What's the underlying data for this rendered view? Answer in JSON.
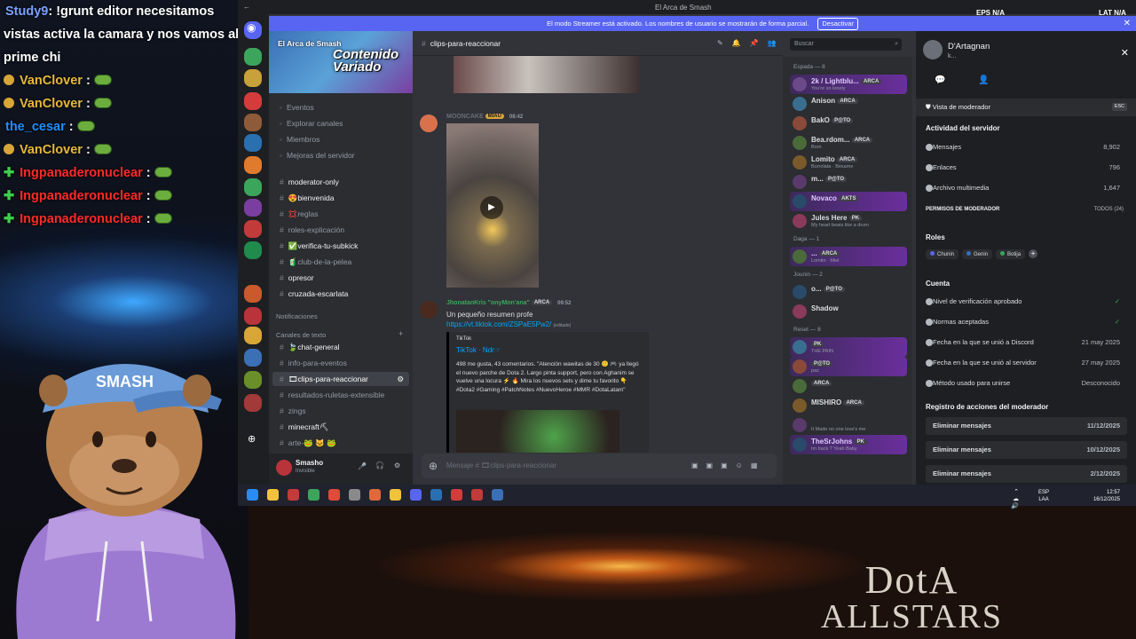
{
  "chat_overlay": [
    {
      "user": "Study9",
      "text": ": !grunt editor necesitamos"
    },
    {
      "user": "",
      "text": "vistas activa la camara y nos vamos al"
    },
    {
      "user": "",
      "text": "prime chi"
    },
    {
      "user": "VanClover",
      "text": " :"
    },
    {
      "user": "VanClover",
      "text": " :"
    },
    {
      "user": "the_cesar",
      "text": " :"
    },
    {
      "user": "VanClover",
      "text": " :"
    },
    {
      "user": "Ingpanaderonuclear",
      "text": " :"
    },
    {
      "user": "Ingpanaderonuclear",
      "text": " :"
    },
    {
      "user": "Ingpanaderonuclear",
      "text": " :"
    }
  ],
  "colors": {
    "vanclover": "#e5b93c",
    "the_cesar": "#1e90ff",
    "ingpanadero": "#ff2a2a",
    "study": "#7aa0ff",
    "blurple": "#5865f2"
  },
  "webcam_overlay": "x317",
  "discord": {
    "window_title": "El Arca de Smash",
    "status_right": "EPS  N/A",
    "status_far": "LAT  N/A",
    "streamer_banner": "El modo Streamer está activado. Los nombres de usuario se mostrarán de forma parcial.",
    "streamer_button": "Desactivar",
    "server_name": "El Arca de Smash",
    "banner_art": "Contenido Variado",
    "nav": [
      "Eventos",
      "Explorar canales",
      "Miembros",
      "Mejoras del servidor"
    ],
    "channels": [
      {
        "name": "moderator-only",
        "strong": true
      },
      {
        "name": "😍bienvenida",
        "strong": true
      },
      {
        "name": "💢reglas",
        "strong": false
      },
      {
        "name": "roles-explicación",
        "strong": false
      },
      {
        "name": "✅verifica-tu-subkick",
        "strong": true
      },
      {
        "name": "🧃club-de-la-pelea",
        "strong": false
      },
      {
        "name": "opresor",
        "strong": true
      },
      {
        "name": "cruzada-escarlata",
        "strong": true
      }
    ],
    "notifications_label": "Notificaciones",
    "text_category": "Canales de texto",
    "text_channels": [
      {
        "name": "🍃chat-general",
        "strong": true,
        "active": false
      },
      {
        "name": "info-para-eventos",
        "strong": false,
        "active": false
      },
      {
        "name": "🎞clips-para-reaccionar",
        "strong": true,
        "active": true
      },
      {
        "name": "resultados-ruletas-extensible",
        "strong": false,
        "active": false
      },
      {
        "name": "zings",
        "strong": false,
        "active": false
      },
      {
        "name": "minecraft⛏",
        "strong": true,
        "active": false
      },
      {
        "name": "arte-🐸 🐱 🐸",
        "strong": false,
        "active": false
      }
    ],
    "user_panel": {
      "name": "Smasho",
      "status": "Invisible"
    },
    "channel_header": "clips-para-reaccionar",
    "search_placeholder": "Buscar",
    "messages": [
      {
        "author": "MOONCAKE",
        "tag": "MIAU",
        "time": "08:42"
      },
      {
        "author": "JhonatanKris \"onyMon'ana\"",
        "tag": "ARCA",
        "time": "09:52",
        "text": "Un pequeño resumen profe",
        "link": "https://vt.tiktok.com/ZSPaE5Pw2/",
        "edited": "(editado)",
        "embed_site": "TikTok",
        "embed_title": "TikTok · Ndr☞",
        "embed_desc": "498 me gusta, 43 comentarios. \"Atención wawitas de 30 🙂 🎮 ya llegó el nuevo parche de Dota 2. Largo pinta support, pero con Aghanim se vuelve una locura ⚡ 🔥 Mira los nuevos sets y dime tu favorito 👇 #Dota2 #Gaming #PatchNotes #NuevoHeroe #MMR #DotaLatam\""
      }
    ],
    "composer_placeholder": "Mensaje # 🎞clips-para-reaccionar",
    "member_groups": [
      {
        "label": "Espada — 8",
        "members": [
          {
            "name": "2k / Lightblu...",
            "status": "You're so lonely",
            "tag": "ARCA",
            "hl": true
          },
          {
            "name": "Anison",
            "status": "",
            "tag": "ARCA",
            "hl": false
          },
          {
            "name": "BakO",
            "status": "",
            "tag": "P@TO",
            "hl": false
          },
          {
            "name": "Bea.rdom...",
            "status": "Born",
            "tag": "ARCA",
            "hl": false
          },
          {
            "name": "Lomito",
            "status": "Burrolata · Bésame",
            "tag": "ARCA",
            "hl": false
          },
          {
            "name": "m...",
            "status": "",
            "tag": "P@TO",
            "hl": false
          },
          {
            "name": "Novaco",
            "status": "",
            "tag": "AKTS",
            "hl": true
          },
          {
            "name": "Jules Here",
            "status": "My heart beats like a drum",
            "tag": "PK",
            "hl": false
          }
        ]
      },
      {
        "label": "Daga — 1",
        "members": [
          {
            "name": "...",
            "status": "Lomito · Miel",
            "tag": "ARCA",
            "hl": true
          }
        ]
      },
      {
        "label": "Jounin — 2",
        "members": [
          {
            "name": "o...",
            "status": "",
            "tag": "P@TO",
            "hl": false
          },
          {
            "name": "Shadow",
            "status": "",
            "tag": "",
            "hl": false
          }
        ]
      },
      {
        "label": "Reset — 8",
        "members": [
          {
            "name": "",
            "status": "THE PAIN",
            "tag": "PK",
            "hl": true
          },
          {
            "name": "",
            "status": "paz",
            "tag": "P@TO",
            "hl": true
          },
          {
            "name": "",
            "status": "",
            "tag": "ARCA",
            "hl": false
          },
          {
            "name": "MISHIRO",
            "status": "",
            "tag": "ARCA",
            "hl": false
          },
          {
            "name": "",
            "status": "It Made no one love's me",
            "tag": "",
            "hl": false
          },
          {
            "name": "TheSrJohns",
            "status": "Im back ? Yeah Baby",
            "tag": "PK",
            "hl": true
          }
        ]
      }
    ],
    "mod_panel": {
      "username": "D'Artagnan",
      "username_sub": "k...",
      "view_label": "Vista de moderador",
      "esc": "ESC",
      "activity_title": "Actividad del servidor",
      "activity": [
        {
          "label": "Mensajes",
          "value": "8,902"
        },
        {
          "label": "Enlaces",
          "value": "796"
        },
        {
          "label": "Archivo multimedia",
          "value": "1,647"
        }
      ],
      "perms_label": "PERMISOS DE MODERADOR",
      "perms_value": "TODOS (24)",
      "roles_title": "Roles",
      "roles": [
        "Chunin",
        "Genin",
        "Botija"
      ],
      "account_title": "Cuenta",
      "account": [
        {
          "label": "Nivel de verificación aprobado",
          "value": "✓"
        },
        {
          "label": "Normas aceptadas",
          "value": "✓"
        },
        {
          "label": "Fecha en la que se unió a Discord",
          "value": "21 may 2025"
        },
        {
          "label": "Fecha en la que se unió al servidor",
          "value": "27 may 2025"
        },
        {
          "label": "Método usado para unirse",
          "value": "Desconocido"
        }
      ],
      "log_title": "Registro de acciones del moderador",
      "log": [
        {
          "label": "Eliminar mensajes",
          "value": "11/12/2025"
        },
        {
          "label": "Eliminar mensajes",
          "value": "10/12/2025"
        },
        {
          "label": "Eliminar mensajes",
          "value": "2/12/2025"
        }
      ]
    }
  },
  "taskbar": {
    "lang": "ESP",
    "lang2": "LAA",
    "time": "12:57",
    "date": "16/12/2025"
  },
  "game_logo": {
    "line1": "DotA",
    "line2": "ALLSTARS"
  }
}
